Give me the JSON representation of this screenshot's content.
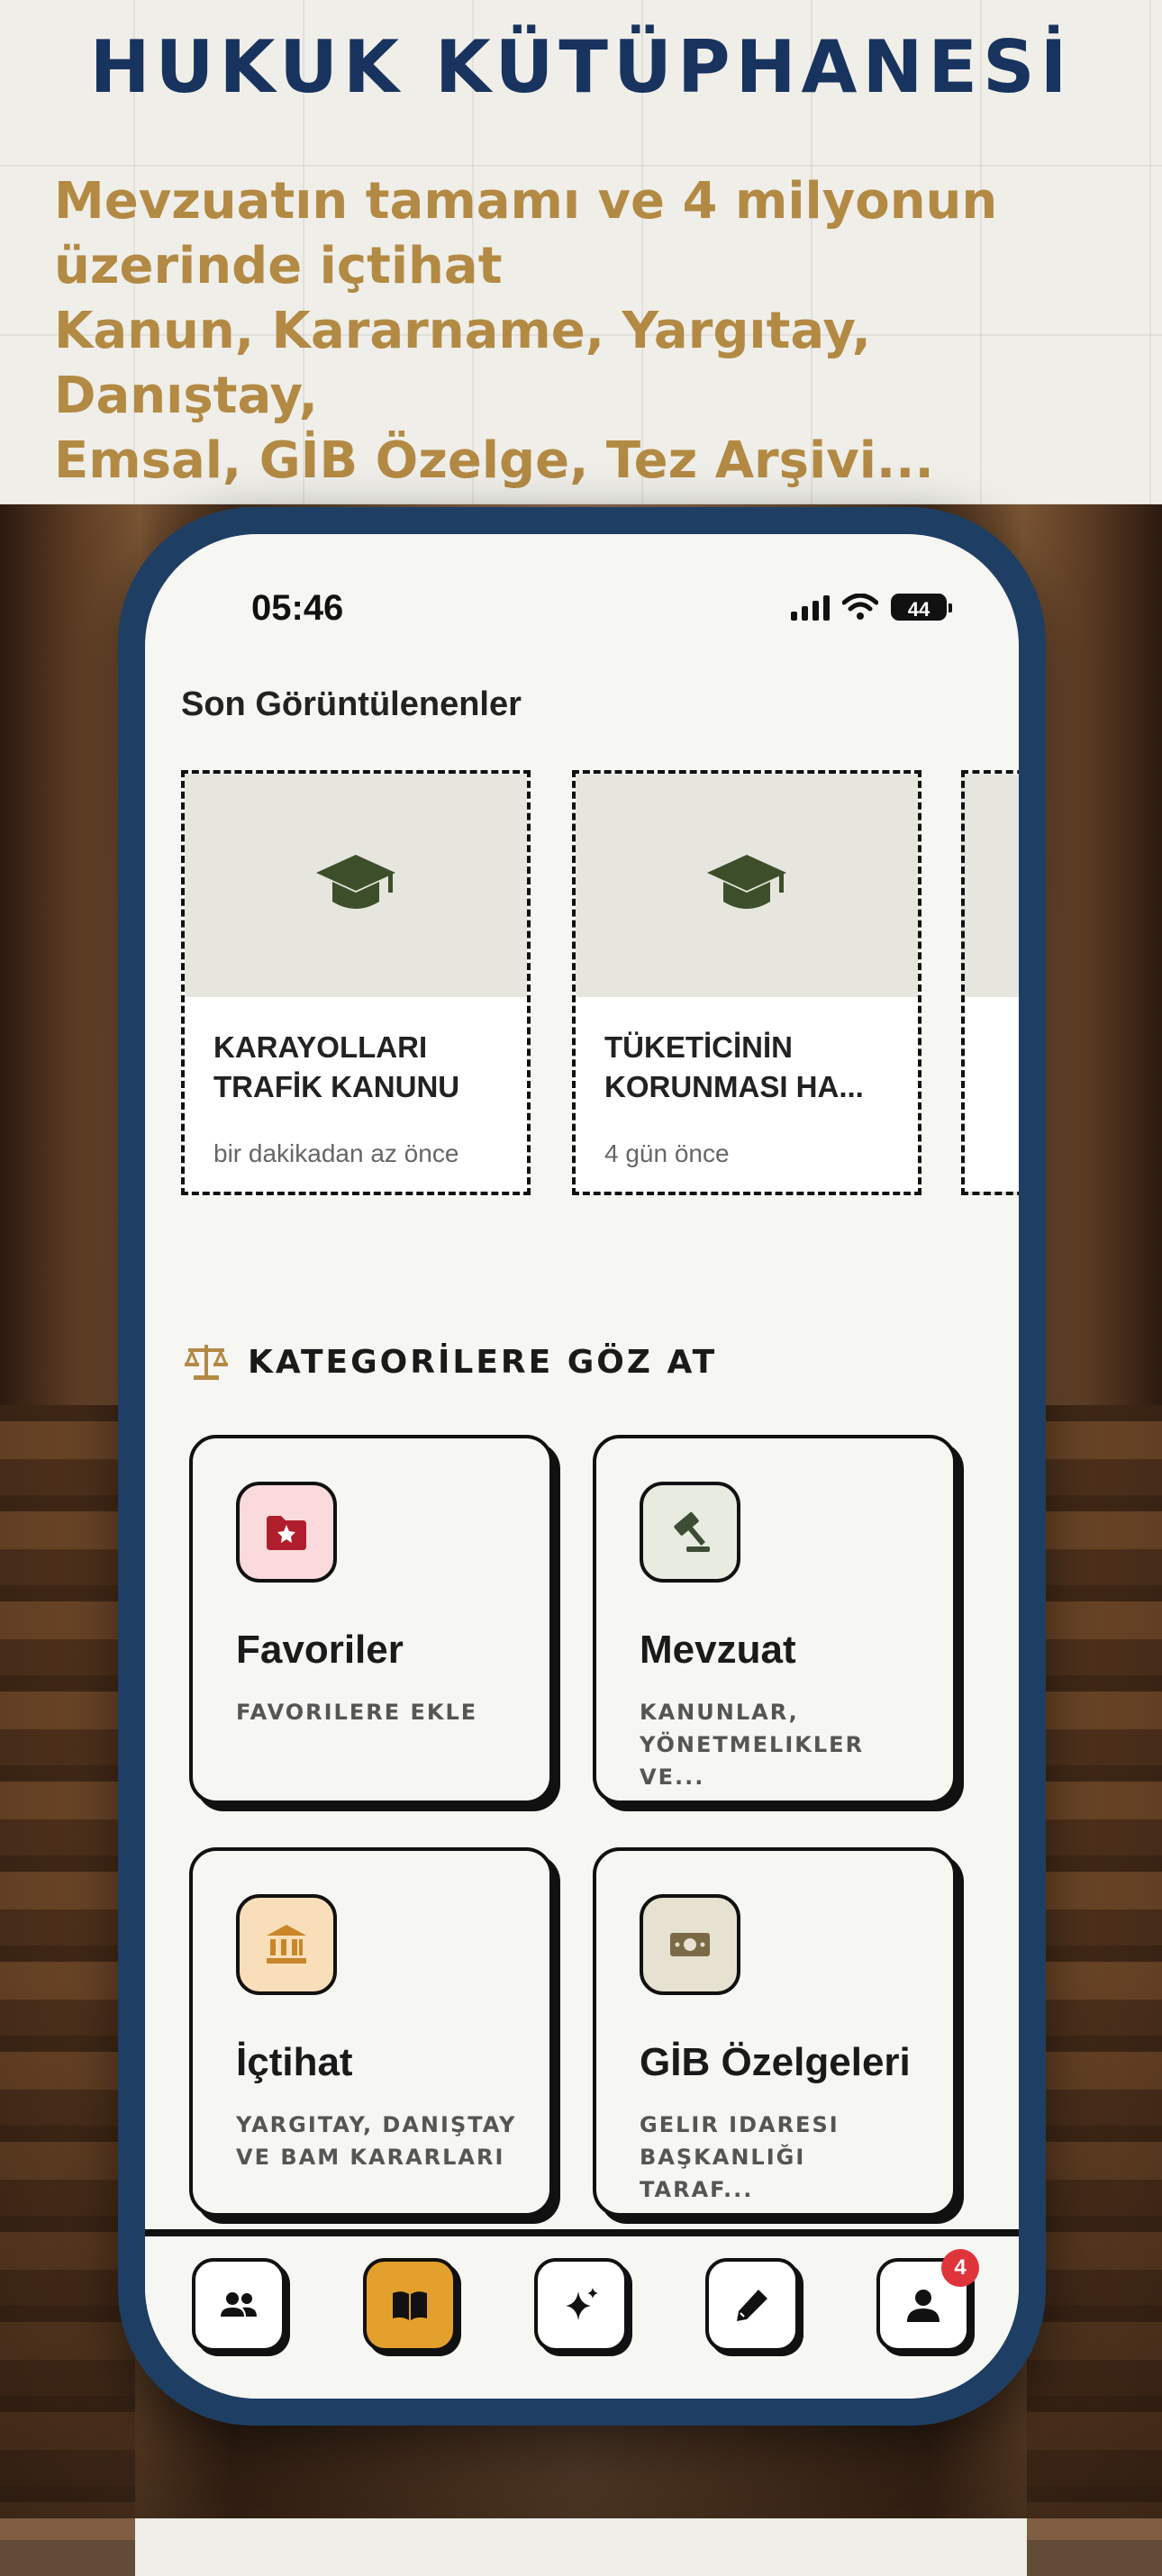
{
  "hero": {
    "title": "HUKUK KÜTÜPHANESİ",
    "subtitle_lines": [
      "Mevzuatın tamamı ve 4 milyonun",
      "üzerinde içtihat",
      "Kanun, Kararname, Yargıtay, Danıştay,",
      "Emsal, GİB Özelge, Tez Arşivi..."
    ]
  },
  "status_bar": {
    "time": "05:46",
    "battery": "44"
  },
  "recent": {
    "title": "Son Görüntülenenler",
    "items": [
      {
        "title": "KARAYOLLARI TRAFİK KANUNU",
        "time": "bir dakikadan az önce",
        "icon": "graduation-cap-icon"
      },
      {
        "title": "TÜKETİCİNİN KORUNMASI HA...",
        "time": "4 gün önce",
        "icon": "graduation-cap-icon"
      }
    ]
  },
  "categories": {
    "title": "KATEGORİLERE GÖZ AT",
    "items": [
      {
        "title": "Favoriler",
        "subtitle": "FAVORILERE EKLE",
        "icon": "star-folder-icon",
        "icon_bg": "#fadadc",
        "icon_color": "#b01e2d"
      },
      {
        "title": "Mevzuat",
        "subtitle": "KANUNLAR, YÖNETMELIKLER VE...",
        "icon": "gavel-icon",
        "icon_bg": "#e8ebdf",
        "icon_color": "#3d4c35"
      },
      {
        "title": "İçtihat",
        "subtitle": "YARGITAY, DANIŞTAY VE BAM KARARLARI",
        "icon": "courthouse-icon",
        "icon_bg": "#f9dfb9",
        "icon_color": "#c8862a"
      },
      {
        "title": "GİB Özelgeleri",
        "subtitle": "GELIR IDARESI BAŞKANLIĞI TARAF...",
        "icon": "banknote-icon",
        "icon_bg": "#e6e1d0",
        "icon_color": "#7a6a45"
      }
    ]
  },
  "nav": {
    "items": [
      {
        "name": "users",
        "icon": "users-icon"
      },
      {
        "name": "library",
        "icon": "book-icon",
        "active": true
      },
      {
        "name": "ai",
        "icon": "sparkles-icon"
      },
      {
        "name": "write",
        "icon": "pen-icon"
      },
      {
        "name": "profile",
        "icon": "user-icon",
        "badge": "4"
      }
    ]
  },
  "colors": {
    "hero_title": "#18335e",
    "hero_subtitle": "#b38a44",
    "phone_frame": "#1f3e63",
    "accent_active": "#e3a02c",
    "badge": "#e0343b",
    "cap_icon": "#3d4f2a"
  }
}
